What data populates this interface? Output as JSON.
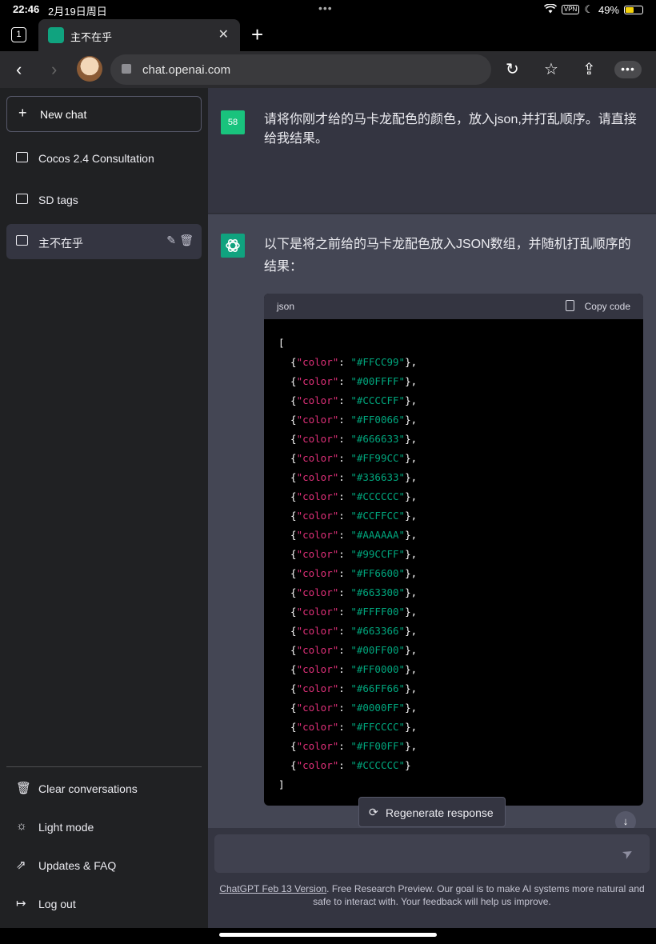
{
  "status_bar": {
    "time": "22:46",
    "date": "2月19日周日",
    "vpn": "VPN",
    "battery": "49%",
    "battery_level": 0.49
  },
  "browser": {
    "tab_count": "1",
    "tab_title": "主不在乎",
    "url": "chat.openai.com",
    "icons": [
      "chevron-left-icon",
      "chevron-right-icon",
      "reload-icon",
      "favorites-icon",
      "share-icon",
      "more-icon"
    ]
  },
  "sidebar": {
    "new_chat": "New chat",
    "conversations": [
      {
        "label": "Cocos 2.4 Consultation"
      },
      {
        "label": "SD tags"
      },
      {
        "label": "主不在乎",
        "active": true
      }
    ],
    "bottom_items": [
      {
        "label": "Clear conversations",
        "icon": "trash-icon"
      },
      {
        "label": "Light mode",
        "icon": "sun-icon"
      },
      {
        "label": "Updates & FAQ",
        "icon": "external-link-icon"
      },
      {
        "label": "Log out",
        "icon": "logout-icon"
      }
    ]
  },
  "chat": {
    "user_avatar_text": "58",
    "user_message": "请将你刚才给的马卡龙配色的颜色，放入json,并打乱顺序。请直接给我结果。",
    "assistant_message": "以下是将之前给的马卡龙配色放入JSON数组，并随机打乱顺序的结果：",
    "code": {
      "lang": "json",
      "copy_label": "Copy code",
      "open": "[",
      "close": "]",
      "key": "\"color\"",
      "values": [
        "\"#FFCC99\"",
        "\"#00FFFF\"",
        "\"#CCCCFF\"",
        "\"#FF0066\"",
        "\"#666633\"",
        "\"#FF99CC\"",
        "\"#336633\"",
        "\"#CCCCCC\"",
        "\"#CCFFCC\"",
        "\"#AAAAAA\"",
        "\"#99CCFF\"",
        "\"#FF6600\"",
        "\"#663300\"",
        "\"#FFFF00\"",
        "\"#663366\"",
        "\"#00FF00\"",
        "\"#FF0000\"",
        "\"#66FF66\"",
        "\"#0000FF\"",
        "\"#FFCCCC\"",
        "\"#FF00FF\"",
        "\"#CCCCCC\""
      ]
    },
    "regenerate": "Regenerate response",
    "input_placeholder": "",
    "footer_link": "ChatGPT Feb 13 Version",
    "footer_text": ". Free Research Preview. Our goal is to make AI systems more natural and safe to interact with. Your feedback will help us improve."
  },
  "colors": {
    "sidebar_bg": "#202123",
    "main_bg": "#343541",
    "assistant_bg": "#444654",
    "accent": "#10a37f",
    "user_avatar": "#19c37d",
    "code_key": "#df3079",
    "code_value": "#00a67d"
  }
}
